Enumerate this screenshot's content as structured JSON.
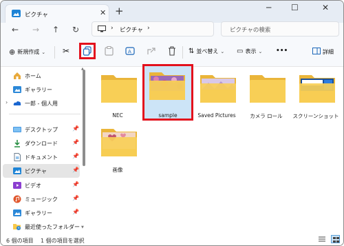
{
  "window": {
    "tab_title": "ピクチャ",
    "new_tab": "+",
    "tab_close": "✕"
  },
  "address": {
    "path_segment": "ピクチャ",
    "search_placeholder": "ピクチャの検索"
  },
  "toolbar": {
    "new_label": "新規作成",
    "sort_label": "並べ替え",
    "view_label": "表示",
    "more": "•••",
    "details_label": "詳細"
  },
  "sidebar": {
    "items": [
      {
        "label": "ホーム",
        "icon": "home-icon"
      },
      {
        "label": "ギャラリー",
        "icon": "gallery-icon"
      },
      {
        "label": "一郎 - 個人用",
        "icon": "onedrive-icon"
      },
      {
        "label": "デスクトップ",
        "icon": "desktop-icon"
      },
      {
        "label": "ダウンロード",
        "icon": "download-icon"
      },
      {
        "label": "ドキュメント",
        "icon": "document-icon"
      },
      {
        "label": "ピクチャ",
        "icon": "pictures-icon"
      },
      {
        "label": "ビデオ",
        "icon": "video-icon"
      },
      {
        "label": "ミュージック",
        "icon": "music-icon"
      },
      {
        "label": "ギャラリー",
        "icon": "gallery-icon"
      },
      {
        "label": "最近使ったフォルダー",
        "icon": "recent-folder-icon"
      }
    ]
  },
  "folders": [
    {
      "label": "NEC"
    },
    {
      "label": "sample"
    },
    {
      "label": "Saved Pictures"
    },
    {
      "label": "カメラ ロール"
    },
    {
      "label": "スクリーンショット"
    },
    {
      "label": "画像"
    }
  ],
  "status": {
    "count": "6 個の項目",
    "selected": "1 個の項目を選択"
  },
  "colors": {
    "highlight": "#e3101c",
    "folder": "#f8c94a",
    "selection": "#cce4f7"
  }
}
